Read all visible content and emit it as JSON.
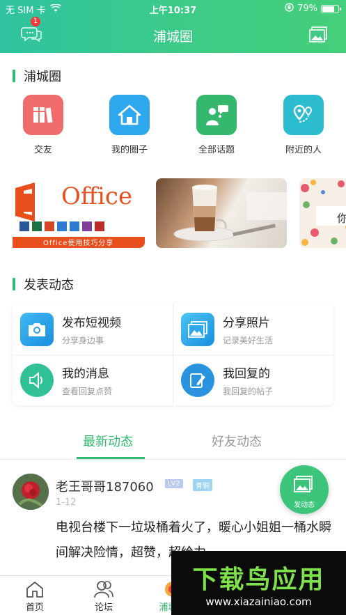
{
  "status_bar": {
    "carrier": "无 SIM 卡",
    "time": "上午10:37",
    "battery": "79%",
    "battery_level": 0.79
  },
  "nav": {
    "title": "浦城圈",
    "badge_count": "1"
  },
  "circle_section": {
    "title": "浦城圈",
    "items": [
      {
        "label": "交友",
        "icon": "books-icon",
        "color": "#f06c6c"
      },
      {
        "label": "我的圈子",
        "icon": "home-icon",
        "color": "#2da8ee"
      },
      {
        "label": "全部话题",
        "icon": "speaker-icon",
        "color": "#35b86e"
      },
      {
        "label": "附近的人",
        "icon": "location-icon",
        "color": "#2bbcd0"
      }
    ]
  },
  "banners": [
    {
      "title": "Office",
      "caption": "Office使用技巧分享"
    },
    {
      "title": ""
    },
    {
      "title": "你"
    }
  ],
  "post_section": {
    "title": "发表动态",
    "actions": [
      {
        "title": "发布短视频",
        "sub": "分享身边事",
        "icon": "camera-icon"
      },
      {
        "title": "分享照片",
        "sub": "记录美好生活",
        "icon": "picture-icon"
      },
      {
        "title": "我的消息",
        "sub": "查看回复点赞",
        "icon": "volume-icon"
      },
      {
        "title": "我回复的",
        "sub": "我回复的帖子",
        "icon": "edit-icon"
      }
    ]
  },
  "feed_tabs": {
    "latest": "最新动态",
    "friends": "好友动态"
  },
  "post": {
    "username": "老王哥哥187060",
    "level": "LV2",
    "grade": "青铜",
    "date": "1-12",
    "text": "电视台楼下一垃圾桶着火了，暖心小姐姐一桶水瞬间解决险情，超赞，超给力"
  },
  "fab": {
    "label": "发动态"
  },
  "tabbar": {
    "home": "首页",
    "forum": "论坛",
    "circle": "浦城圈"
  },
  "watermark": {
    "title": "下载鸟应用",
    "url": "www.xiazainiao.com"
  }
}
